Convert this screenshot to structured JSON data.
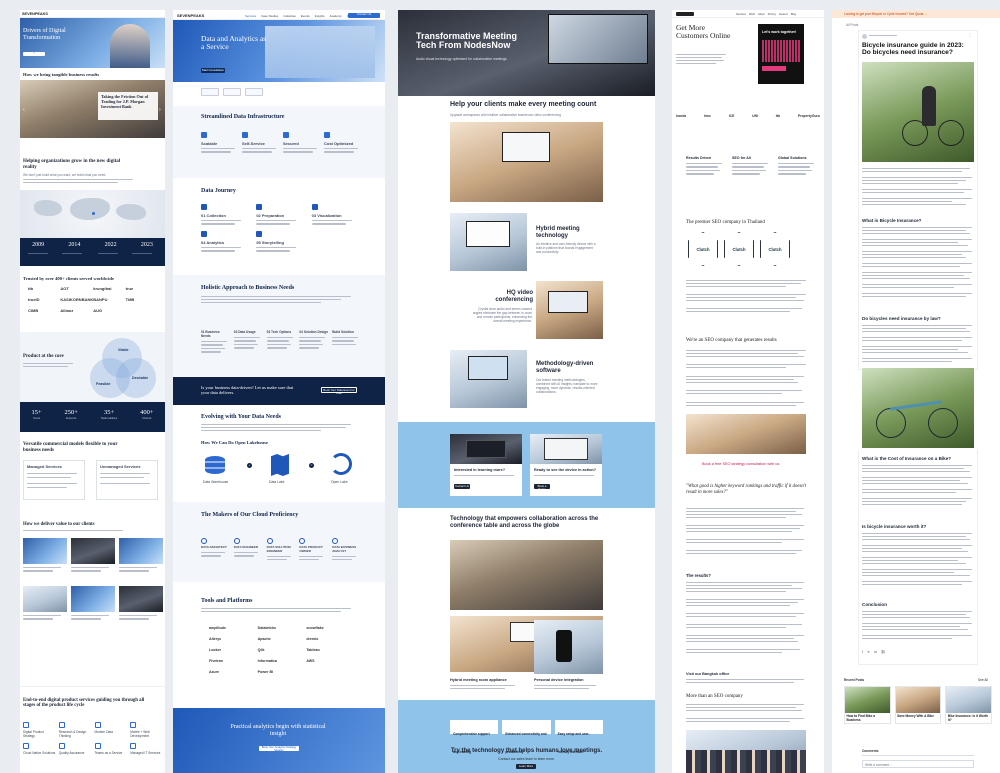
{
  "col1": {
    "logo": "SEVENPEAKS",
    "hero_title": "Drivers of Digital Transformation",
    "tangible_heading": "How we bring tangible business results",
    "case_title": "Taking the Friction Out of Trading for J.P. Morgan Investment Bank",
    "growing_heading": "Helping organizations grow in the new digital reality",
    "growing_sub": "We don't just build what you want, we build what you need.",
    "years": [
      "2009",
      "2014",
      "2022",
      "2023"
    ],
    "trusted_heading": "Trusted by over 400+ clients served worldwide",
    "client_logos": [
      "ttb",
      "AOT",
      "krungthai",
      "true",
      "truelD",
      "KASIKORNBANK",
      "BANPU",
      "TMB",
      "CIMB",
      "Allianz",
      "AUG"
    ],
    "product_heading": "Product at the core",
    "venn": [
      "Viable",
      "Feasible",
      "Desirable"
    ],
    "stats": [
      {
        "n": "15+",
        "l": "Years"
      },
      {
        "n": "250+",
        "l": "Experts"
      },
      {
        "n": "35+",
        "l": "Nationalities"
      },
      {
        "n": "400+",
        "l": "Clients"
      }
    ],
    "versatile_heading": "Versatile commercial models flexible to your business needs",
    "models": [
      "Managed Services",
      "Unmanaged Services"
    ],
    "deliver_heading": "How we deliver value to our clients",
    "end_heading": "End-to-end digital product services guiding you through all stages of the product life cycle",
    "services": [
      "Digital Product Strategy",
      "Research & Design Thinking",
      "Modern Data",
      "Mobile + Web Development",
      "Cloud Native Solutions",
      "Quality Assurance",
      "Teams as a Service",
      "Managed IT Services"
    ]
  },
  "col2": {
    "logo": "SEVENPEAKS",
    "nav": [
      "Services",
      "Case Studies",
      "Industries",
      "Events",
      "Insights",
      "Academy",
      "Careers",
      "Contact Us"
    ],
    "hero_title": "Data and Analytics as a Service",
    "hero_btn": "Start Consultation",
    "streamlined_heading": "Streamlined Data Infrastructure",
    "streamlined_items": [
      "Scalable",
      "Self-Service",
      "Secured",
      "Cost Optimized"
    ],
    "journey_heading": "Data Journey",
    "journey_steps": [
      "01 Collection",
      "02 Preparation",
      "03 Visualization",
      "04 Analytics",
      "05 Storytelling"
    ],
    "holistic_heading": "Holistic Approach to Business Needs",
    "holistic_cols": [
      "01 Business Needs",
      "02 Data Usage",
      "03 Tech Options",
      "04 Solution Design",
      "Build Solution"
    ],
    "banner_text": "Is your business data-driven? Let us make sure that your data delivers.",
    "banner_btn": "Book Your Data Event for Free",
    "evolving_heading": "Evolving with Your Data Needs",
    "lakehouse_heading": "How We Can Do Open Lakehouse",
    "lake_labels": [
      "Data Warehouse",
      "Data Lake",
      "Open Lake"
    ],
    "makers_heading": "The Makers of Our Cloud Proficiency",
    "makers": [
      "DATA ARCHITECT",
      "DATA ENGINEER",
      "DATA SOLUTION ENGINEER",
      "DATA PRODUCT OWNER",
      "DATA BUSINESS ANALYST"
    ],
    "tools_heading": "Tools and Platforms",
    "tools": [
      "amplitude",
      "Databricks",
      "snowflake",
      "Alteryx",
      "Apache",
      "dremio",
      "Looker",
      "Qlik",
      "Tableau",
      "Fivetran",
      "Informatica",
      "AWS",
      "Azure",
      "Power BI"
    ],
    "footer_title": "Practical analytics begin with statistical insight",
    "footer_btn": "Book Your Analytics Strategy Session"
  },
  "col3": {
    "hero_title": "Transformative Meeting Tech From NodesNow",
    "hero_sub": "Audio visual technology optimised for collaborative meetings",
    "meeting_heading": "Help your clients make every meeting count",
    "meeting_sub": "Upgrade workspaces with intuitive collaborative boardroom video conferencing",
    "features": [
      {
        "title": "Hybrid meeting technology",
        "body": "An intuitive and user-friendly device with a built-in platform that boosts engagement and productivity."
      },
      {
        "title": "HQ video conferencing",
        "body": "Crystal clear audio and stereo camera angles eliminate the gap between in-room and remote participants, enhancing the overall meeting experience."
      },
      {
        "title": "Methodology-driven software",
        "body": "Our tested meeting methodologies, combined with AI insights, translate to more engaging, more dynamic, results-oriented collaborations."
      }
    ],
    "cta_cards": [
      {
        "title": "Interested in learning more?",
        "btn": "Contact Us"
      },
      {
        "title": "Ready to see the device in action?",
        "btn": "Book a Demo"
      }
    ],
    "tech_heading": "Technology that empowers collaboration across the conference table and across the globe",
    "products": [
      "Hybrid meeting room appliance",
      "Personal device integration"
    ],
    "benefits": [
      "Comprehensive support and training",
      "Enhanced connectivity and productivity",
      "Easy setup and user-friendly interface"
    ],
    "footer_title": "Try the technology that helps humans love meetings.",
    "footer_sub": "Contact our sales team to learn more.",
    "footer_btn": "Learn More"
  },
  "col4": {
    "nav": [
      "Services",
      "Work",
      "About",
      "Pricing",
      "Careers",
      "Blog"
    ],
    "hero_title": "Get More Customers Online",
    "badge": "Let's work together!",
    "client_logos": [
      "honda",
      "hmc",
      "ICE",
      "UNI",
      "ttb",
      "PropertyGuru"
    ],
    "pillars": [
      "Results Driven",
      "SEO for All",
      "Global Solutions"
    ],
    "premier_heading": "The premier SEO company in Thailand",
    "clutch": [
      "Clutch",
      "Clutch",
      "Clutch"
    ],
    "results_heading": "We're an SEO company that generates results",
    "cta_link": "Book a free SEO strategy consultation with us",
    "quote": "\"What good is higher keyword rankings and traffic if it doesn't result in more sales?\"",
    "results_q": "The results?",
    "visit": "Visit our Bangkok office",
    "more_heading": "More than an SEO company"
  },
  "col5": {
    "top_banner": "Looking to get your Bicycle or Cycle Insured? Get Quote →",
    "crumb": "All Posts",
    "title": "Bicycle insurance guide in 2023: Do bicycles need insurance?",
    "h_what": "What is Bicycle Insurance?",
    "h_law": "Do bicycles need insurance by law?",
    "h_cost": "What is the Cost of Insurance on a Bike?",
    "h_worth": "Is bicycle insurance worth it?",
    "h_conclusion": "Conclusion",
    "recent": "Recent Posts",
    "see_all": "See All",
    "recent_posts": [
      "How to Find Bike a Business",
      "Save Money With A Bike",
      "Bike Insurance: Is it Worth It?"
    ],
    "comments": "Comments",
    "comment_placeholder": "Write a comment..."
  }
}
